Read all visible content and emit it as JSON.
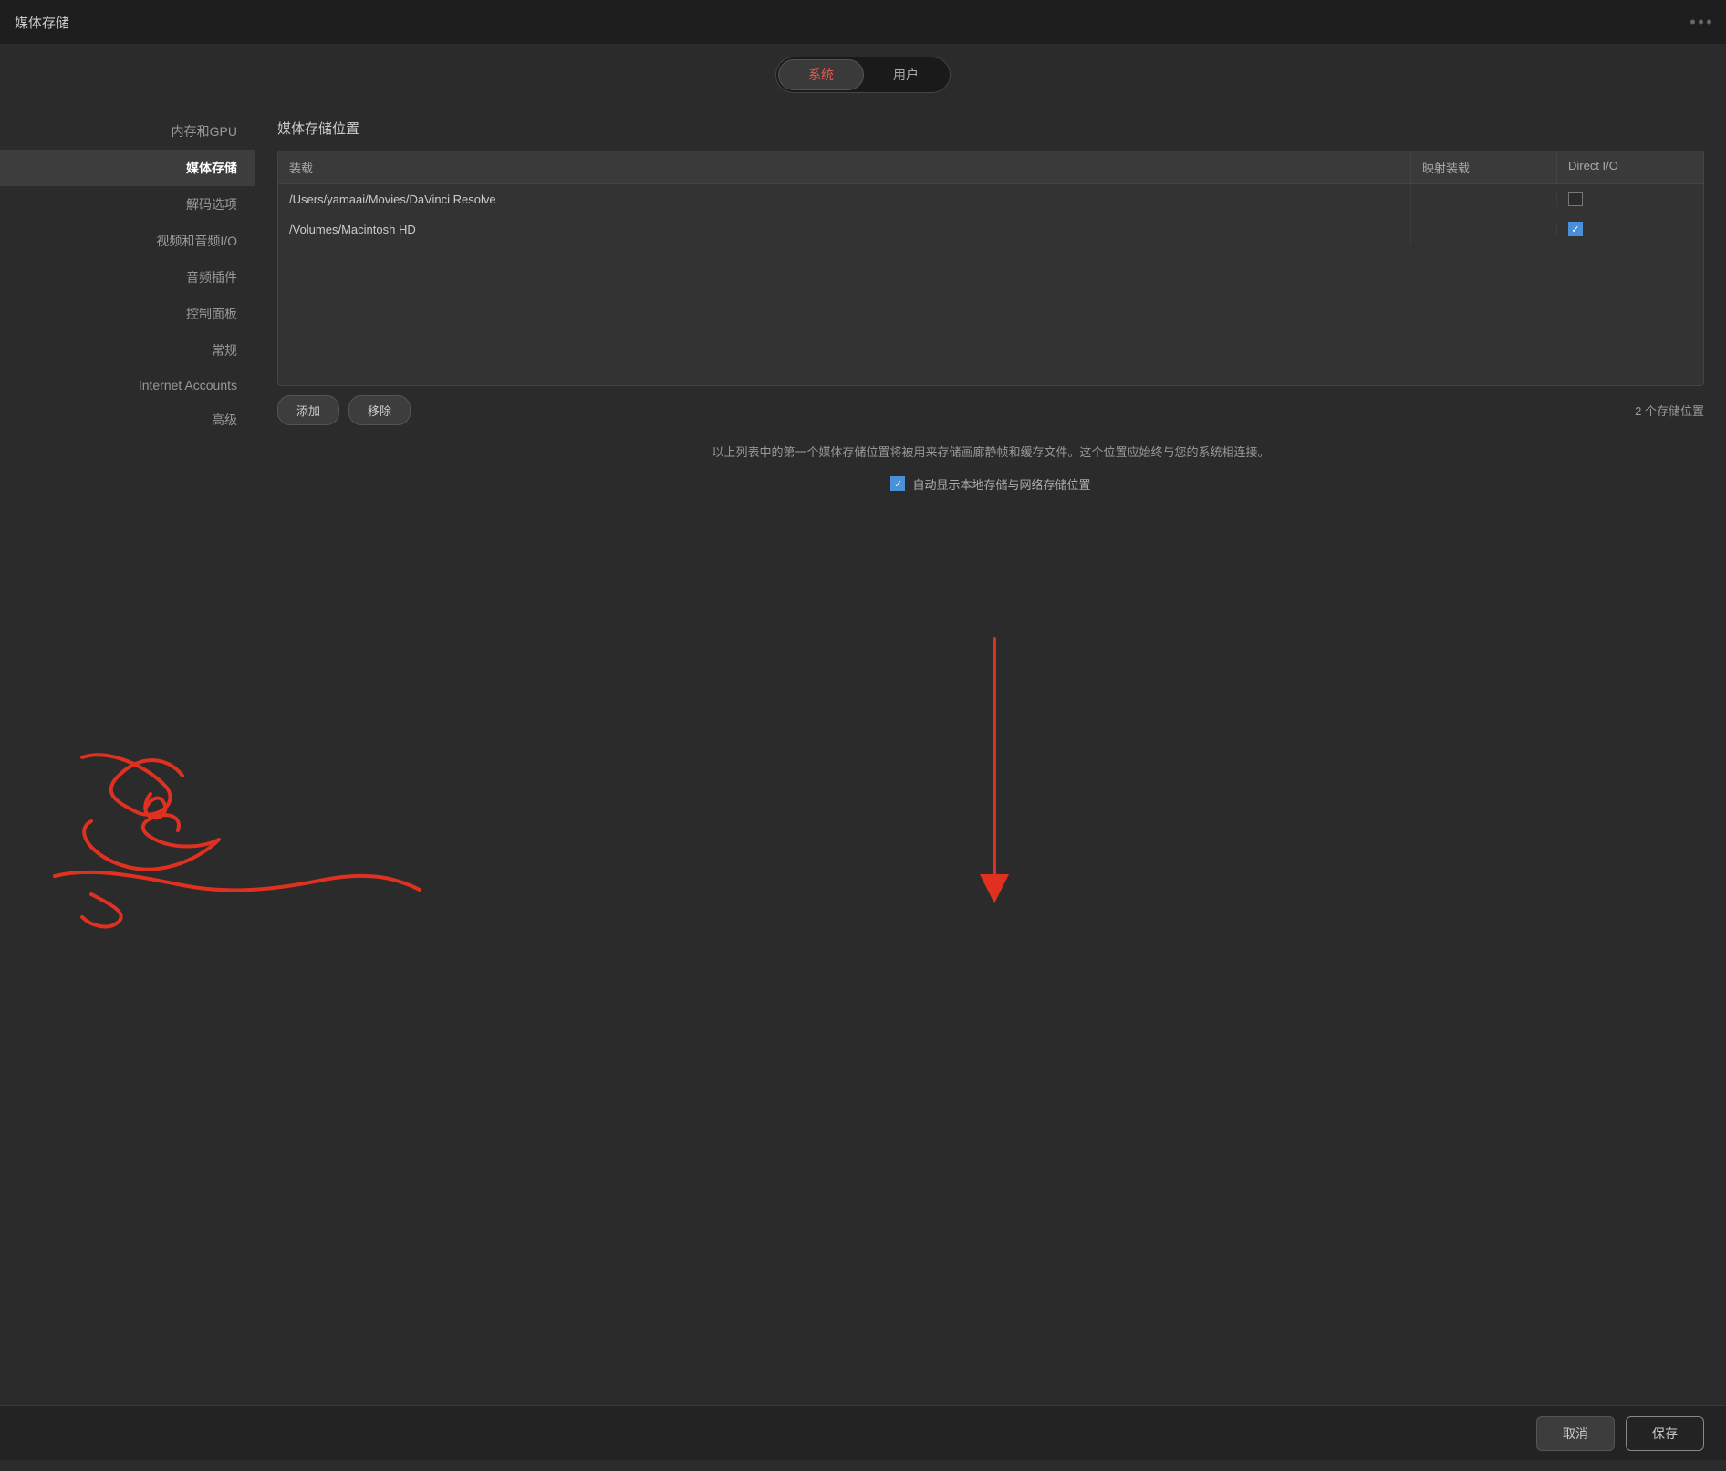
{
  "window": {
    "title": "媒体存储",
    "dots": [
      "●",
      "●",
      "●"
    ]
  },
  "tabs": {
    "system": "系统",
    "user": "用户",
    "active": "system"
  },
  "sidebar": {
    "items": [
      {
        "id": "memory-gpu",
        "label": "内存和GPU",
        "active": false
      },
      {
        "id": "media-storage",
        "label": "媒体存储",
        "active": true
      },
      {
        "id": "decode-options",
        "label": "解码选项",
        "active": false
      },
      {
        "id": "video-audio-io",
        "label": "视频和音频I/O",
        "active": false
      },
      {
        "id": "audio-plugins",
        "label": "音频插件",
        "active": false
      },
      {
        "id": "control-panel",
        "label": "控制面板",
        "active": false
      },
      {
        "id": "general",
        "label": "常规",
        "active": false
      },
      {
        "id": "internet-accounts",
        "label": "Internet Accounts",
        "active": false
      },
      {
        "id": "advanced",
        "label": "高级",
        "active": false
      }
    ]
  },
  "content": {
    "section_title": "媒体存储位置",
    "table": {
      "headers": [
        "装载",
        "映射装载",
        "Direct I/O"
      ],
      "rows": [
        {
          "mount": "/Users/yamaai/Movies/DaVinci Resolve",
          "mapped_mount": "",
          "direct_io": false
        },
        {
          "mount": "/Volumes/Macintosh HD",
          "mapped_mount": "",
          "direct_io": true
        }
      ]
    },
    "add_button": "添加",
    "remove_button": "移除",
    "storage_count": "2 个存储位置",
    "info_text": "以上列表中的第一个媒体存储位置将被用来存储画廊静帧和缓存文件。这个位置应始终与您的系统相连接。",
    "auto_checkbox_label": "自动显示本地存储与网络存储位置",
    "auto_checked": true
  },
  "bottom_bar": {
    "cancel_label": "取消",
    "save_label": "保存"
  }
}
